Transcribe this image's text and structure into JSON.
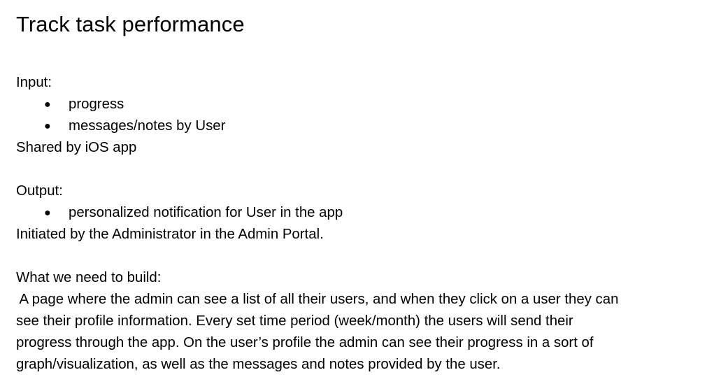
{
  "title": "Track task performance",
  "input": {
    "label": "Input:",
    "items": [
      "progress",
      "messages/notes by User"
    ],
    "note": "Shared by iOS app"
  },
  "output": {
    "label": "Output:",
    "items": [
      "personalized notification for User in the app"
    ],
    "note": "Initiated by the Administrator in the Admin Portal."
  },
  "build": {
    "label": "What we need to build:",
    "lines": [
      " A page where the admin can see a list of all their users, and when they click on a user they can",
      "see their profile information. Every set time period (week/month) the users will send their",
      "progress through the app. On the user’s profile the admin can see their progress in a sort of",
      "graph/visualization, as well as the messages and notes provided by the user."
    ]
  }
}
